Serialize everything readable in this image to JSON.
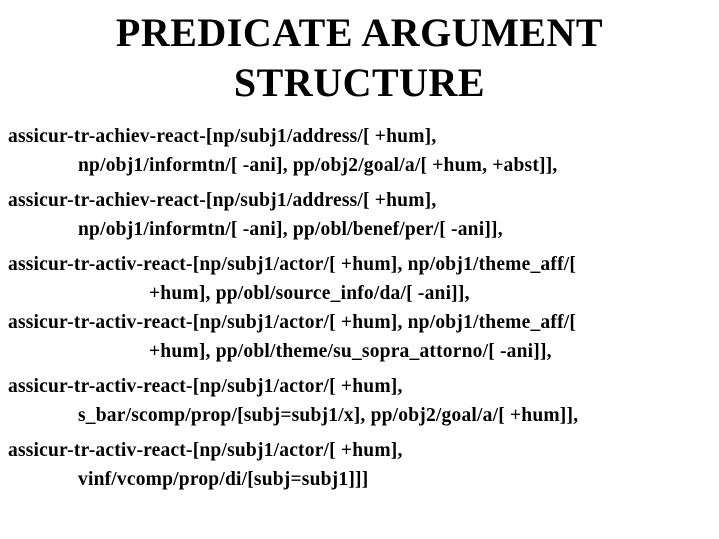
{
  "title": {
    "line1": "PREDICATE ARGUMENT",
    "line2": "STRUCTURE"
  },
  "entries": [
    {
      "line1": "assicur-tr-achiev-react-[np/subj1/address/[ +hum],",
      "line2": "np/obj1/informtn/[ -ani], pp/obj2/goal/a/[ +hum, +abst]],"
    },
    {
      "line1": "assicur-tr-achiev-react-[np/subj1/address/[ +hum],",
      "line2": "np/obj1/informtn/[ -ani], pp/obl/benef/per/[ -ani]],"
    },
    {
      "line1": "assicur-tr-activ-react-[np/subj1/actor/[ +hum], np/obj1/theme_aff/[",
      "line2": "+hum], pp/obl/source_info/da/[ -ani]],"
    },
    {
      "line1": "assicur-tr-activ-react-[np/subj1/actor/[ +hum], np/obj1/theme_aff/[",
      "line2": "+hum], pp/obl/theme/su_sopra_attorno/[ -ani]],"
    },
    {
      "line1": "assicur-tr-activ-react-[np/subj1/actor/[ +hum],",
      "line2": "s_bar/scomp/prop/[subj=subj1/x], pp/obj2/goal/a/[ +hum]],"
    },
    {
      "line1": "assicur-tr-activ-react-[np/subj1/actor/[ +hum],",
      "line2": "vinf/vcomp/prop/di/[subj=subj1]]]"
    }
  ]
}
